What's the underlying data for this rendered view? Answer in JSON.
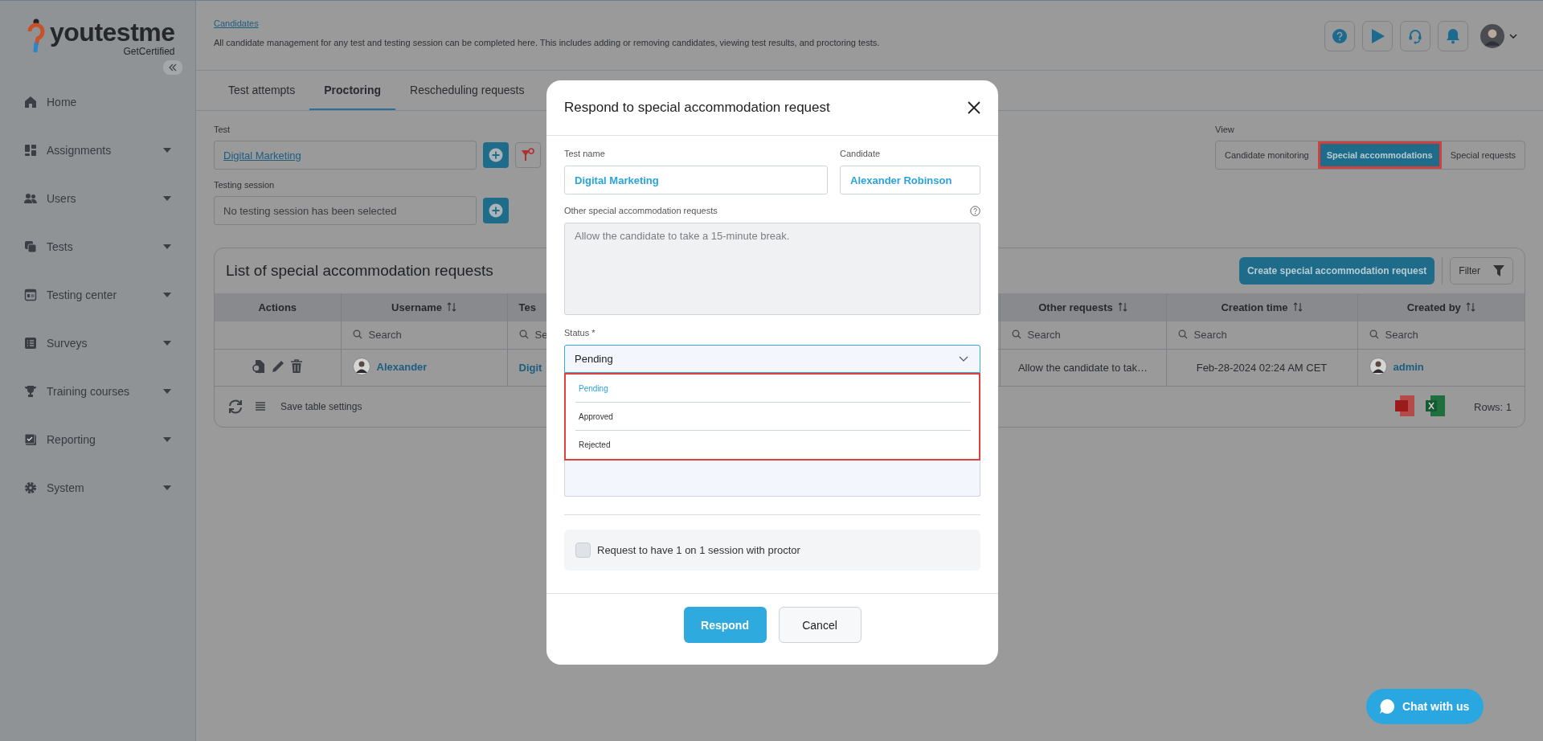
{
  "logo": {
    "name": "youtestme",
    "tagline": "GetCertified"
  },
  "sidebar": {
    "items": [
      {
        "label": "Home",
        "expandable": false
      },
      {
        "label": "Assignments",
        "expandable": true
      },
      {
        "label": "Users",
        "expandable": true
      },
      {
        "label": "Tests",
        "expandable": true
      },
      {
        "label": "Testing center",
        "expandable": true
      },
      {
        "label": "Surveys",
        "expandable": true
      },
      {
        "label": "Training courses",
        "expandable": true
      },
      {
        "label": "Reporting",
        "expandable": true
      },
      {
        "label": "System",
        "expandable": true
      }
    ]
  },
  "header": {
    "breadcrumb": "Candidates",
    "description": "All candidate management for any test and testing session can be completed here. This includes adding or removing candidates, viewing test results, and proctoring tests."
  },
  "tabs": [
    {
      "label": "Test attempts",
      "selected": false
    },
    {
      "label": "Proctoring",
      "selected": true
    },
    {
      "label": "Rescheduling requests",
      "selected": false
    }
  ],
  "filters": {
    "test_label": "Test",
    "test_value": "Digital Marketing",
    "session_label": "Testing session",
    "session_placeholder": "No testing session has been selected"
  },
  "view": {
    "label": "View",
    "options": [
      {
        "label": "Candidate monitoring",
        "selected": false,
        "highlighted": false
      },
      {
        "label": "Special accommodations",
        "selected": true,
        "highlighted": true
      },
      {
        "label": "Special requests",
        "selected": false,
        "highlighted": false
      }
    ]
  },
  "table": {
    "title": "List of special accommodation requests",
    "create_button": "Create special accommodation request",
    "filter_button": "Filter",
    "columns": [
      {
        "label": "Actions",
        "sortable": false
      },
      {
        "label": "Username",
        "sortable": true,
        "search": "Search"
      },
      {
        "label": "Tes",
        "sortable": false,
        "search": "Se"
      },
      {
        "label": "Other requests",
        "sortable": true,
        "search": "Search"
      },
      {
        "label": "Creation time",
        "sortable": true,
        "search": "Search"
      },
      {
        "label": "Created by",
        "sortable": true,
        "search": "Search"
      }
    ],
    "rows": [
      [
        {
          "kind": "actions"
        },
        {
          "kind": "user",
          "text": "Alexander"
        },
        {
          "kind": "link",
          "text": "Digit"
        },
        {
          "kind": "text",
          "text": "Allow the candidate to tak…"
        },
        {
          "kind": "text",
          "text": "Feb-28-2024 02:24 AM CET"
        },
        {
          "kind": "user",
          "text": "admin"
        }
      ]
    ],
    "save_settings": "Save table settings",
    "row_count": "Rows: 1"
  },
  "modal": {
    "title": "Respond to special accommodation request",
    "test_name_label": "Test name",
    "test_name": "Digital Marketing",
    "candidate_label": "Candidate",
    "candidate": "Alexander Robinson",
    "other_label": "Other special accommodation requests",
    "other_value": "Allow the candidate to take a 15-minute break.",
    "status_label": "Status *",
    "status_value": "Pending",
    "dropdown_highlighted": true,
    "status_options": [
      {
        "label": "Pending",
        "selected": true
      },
      {
        "label": "Approved",
        "selected": false
      },
      {
        "label": "Rejected",
        "selected": false
      }
    ],
    "checkbox": {
      "label": "Request to have 1 on 1 session with proctor",
      "checked": false
    },
    "respond_button": "Respond",
    "cancel_button": "Cancel"
  },
  "chat_button": "Chat with us"
}
